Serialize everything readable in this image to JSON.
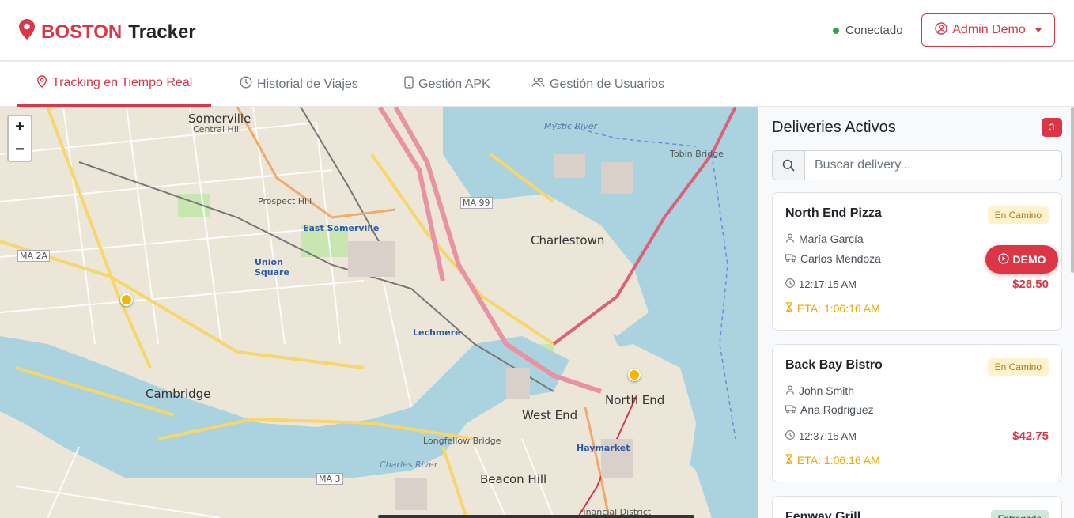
{
  "header": {
    "brand_red": "BOSTON",
    "brand_dark": "Tracker",
    "status": "Conectado",
    "user": "Admin Demo"
  },
  "tabs": [
    {
      "label": "Tracking en Tiempo Real",
      "icon": "map-pin-icon",
      "active": true
    },
    {
      "label": "Historial de Viajes",
      "icon": "clock-icon",
      "active": false
    },
    {
      "label": "Gestión APK",
      "icon": "phone-icon",
      "active": false
    },
    {
      "label": "Gestión de Usuarios",
      "icon": "users-icon",
      "active": false
    }
  ],
  "map": {
    "zoom_in": "+",
    "zoom_out": "−",
    "labels": {
      "somerville": "Somerville",
      "cambridge": "Cambridge",
      "charlestown": "Charlestown",
      "west_end": "West End",
      "north_end": "North End",
      "beacon_hill": "Beacon Hill",
      "east_somerville": "East Somerville",
      "union_square": "Union Square",
      "lechmere": "Lechmere",
      "longfellow": "Longfellow Bridge",
      "haymarket": "Haymarket",
      "charles_river": "Charles River",
      "mystic_river": "Mystic River",
      "tobin_bridge": "Tobin Bridge",
      "prospect_hill": "Prospect Hill",
      "ma99": "MA 99",
      "ma2a": "MA 2A",
      "ma3": "MA 3",
      "central_hill": "Central Hill",
      "financial_district": "Financial District"
    }
  },
  "sidebar": {
    "title": "Deliveries Activos",
    "count": "3",
    "search_placeholder": "Buscar delivery...",
    "demo_label": "DEMO",
    "cards": [
      {
        "restaurant": "North End Pizza",
        "status": "En Camino",
        "customer": "María García",
        "driver": "Carlos Mendoza",
        "time": "12:17:15 AM",
        "price": "$28.50",
        "eta": "ETA: 1:06:16 AM"
      },
      {
        "restaurant": "Back Bay Bistro",
        "status": "En Camino",
        "customer": "John Smith",
        "driver": "Ana Rodriguez",
        "time": "12:37:15 AM",
        "price": "$42.75",
        "eta": "ETA: 1:06:16 AM"
      },
      {
        "restaurant": "Fenway Grill",
        "status": "Entregado"
      }
    ]
  },
  "colors": {
    "accent": "#dc3545",
    "online": "#28a745",
    "eta": "#f0a500",
    "marker": "#f4b400"
  }
}
